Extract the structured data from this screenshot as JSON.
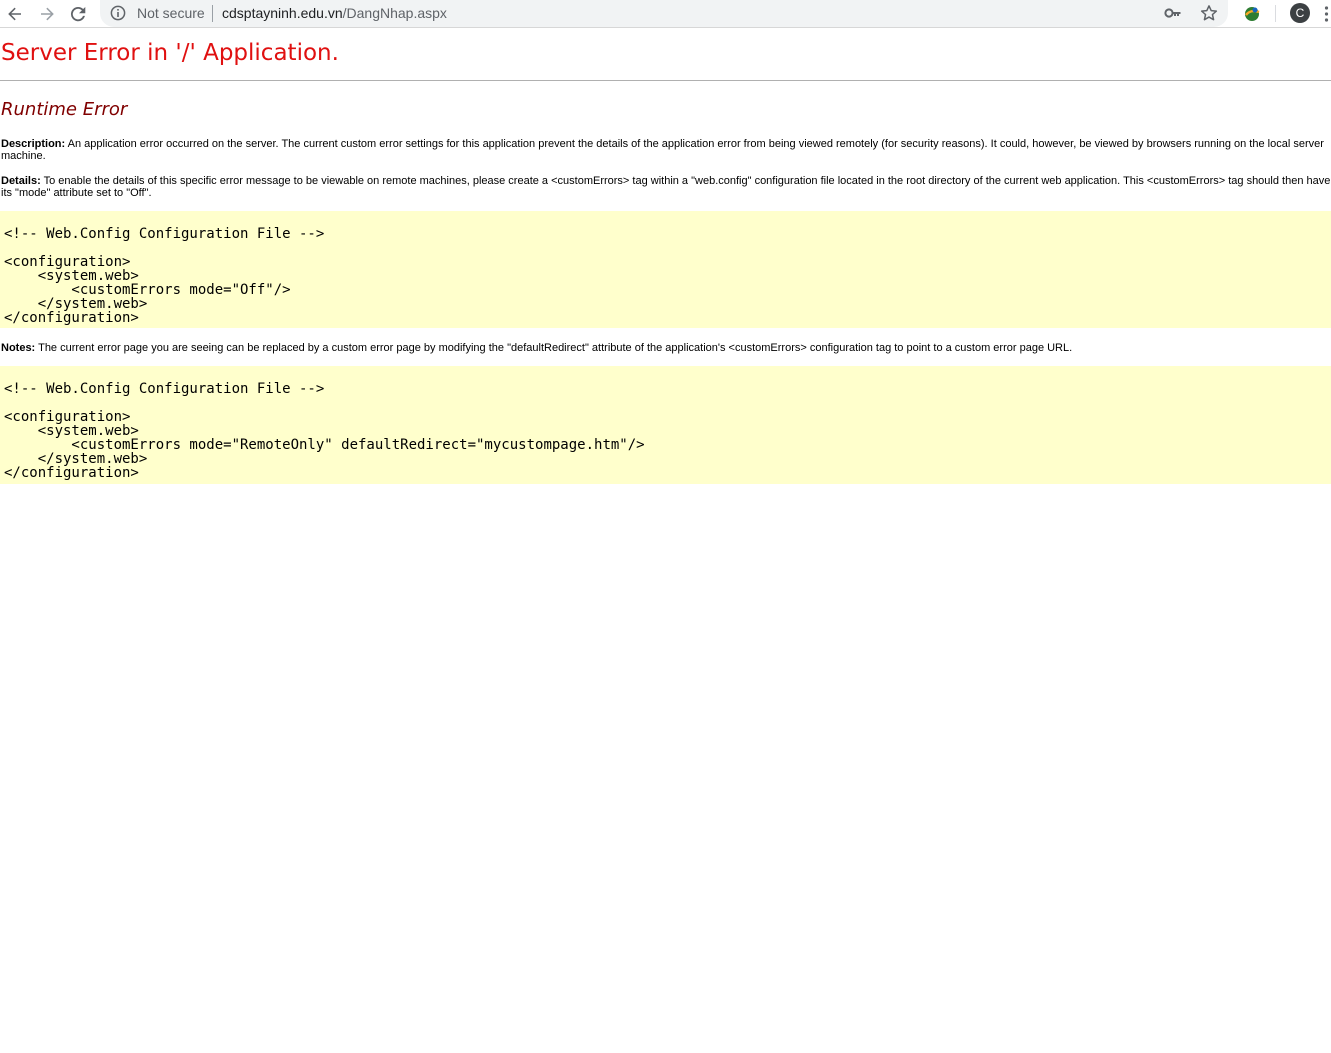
{
  "browser": {
    "nav": {
      "back": "back-icon",
      "forward": "forward-icon",
      "reload": "reload-icon"
    },
    "omnibox": {
      "security_label": "Not secure",
      "url_host": "cdsptayninh.edu.vn",
      "url_path": "/DangNhap.aspx"
    },
    "profile_initial": "C"
  },
  "page": {
    "title": "Server Error in '/' Application.",
    "subtitle": "Runtime Error",
    "description_label": "Description:",
    "description_text": "An application error occurred on the server. The current custom error settings for this application prevent the details of the application error from being viewed remotely (for security reasons). It could, however, be viewed by browsers running on the local server machine.",
    "details_label": "Details:",
    "details_text": "To enable the details of this specific error message to be viewable on remote machines, please create a <customErrors> tag within a \"web.config\" configuration file located in the root directory of the current web application. This <customErrors> tag should then have its \"mode\" attribute set to \"Off\".",
    "code_block_1": "<!-- Web.Config Configuration File -->\n\n<configuration>\n    <system.web>\n        <customErrors mode=\"Off\"/>\n    </system.web>\n</configuration>",
    "notes_label": "Notes:",
    "notes_text": "The current error page you are seeing can be replaced by a custom error page by modifying the \"defaultRedirect\" attribute of the application's <customErrors> configuration tag to point to a custom error page URL.",
    "code_block_2": "<!-- Web.Config Configuration File -->\n\n<configuration>\n    <system.web>\n        <customErrors mode=\"RemoteOnly\" defaultRedirect=\"mycustompage.htm\"/>\n    </system.web>\n</configuration>"
  }
}
